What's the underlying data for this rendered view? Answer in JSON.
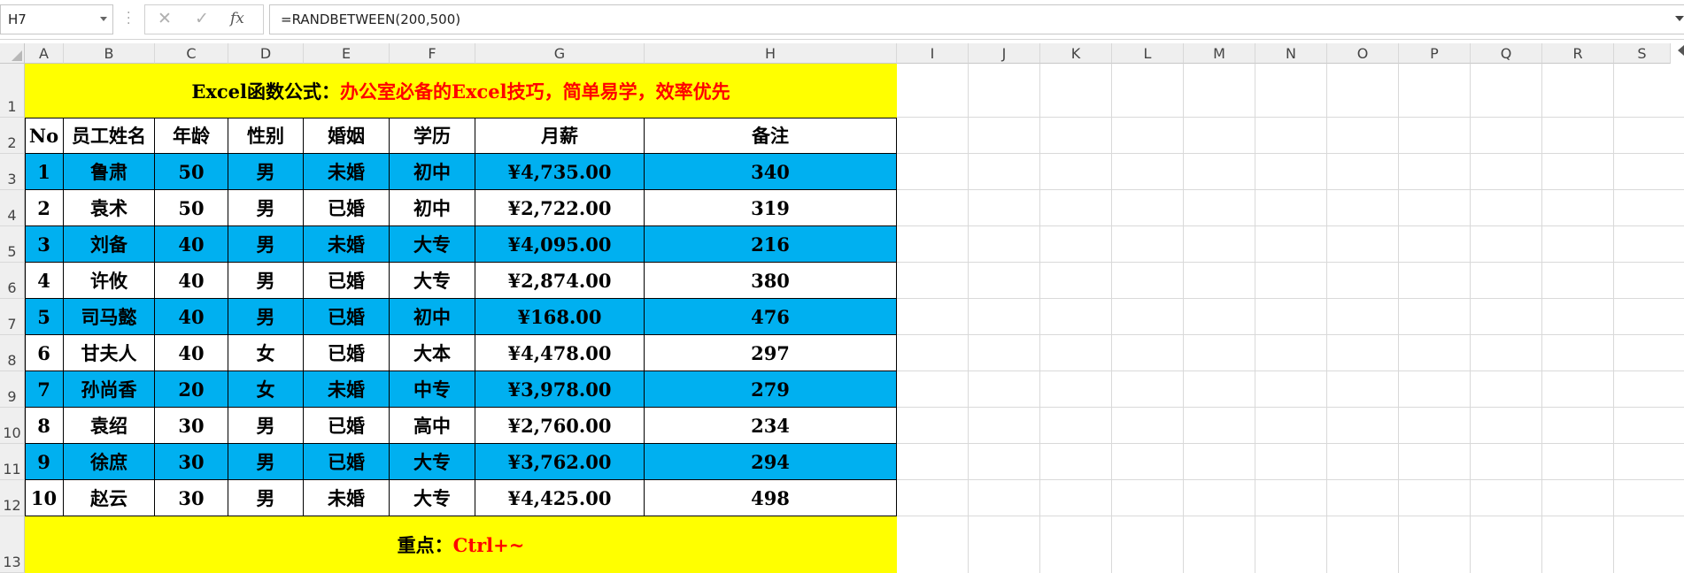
{
  "formula_bar": {
    "name_box": "H7",
    "cancel_icon": "✕",
    "enter_icon": "✓",
    "fx_label": "fx",
    "formula": "=RANDBETWEEN(200,500)"
  },
  "columns": [
    "A",
    "B",
    "C",
    "D",
    "E",
    "F",
    "G",
    "H",
    "I",
    "J",
    "K",
    "L",
    "M",
    "N",
    "O",
    "P",
    "Q",
    "R",
    "S"
  ],
  "rows": [
    "1",
    "2",
    "3",
    "4",
    "5",
    "6",
    "7",
    "8",
    "9",
    "10",
    "11",
    "12",
    "13"
  ],
  "banner_top": {
    "black": "Excel函数公式：",
    "red": "办公室必备的Excel技巧，简单易学，效率优先"
  },
  "banner_bottom": {
    "black": "重点：",
    "red": "Ctrl+~"
  },
  "table": {
    "headers": [
      "No",
      "员工姓名",
      "年龄",
      "性别",
      "婚姻",
      "学历",
      "月薪",
      "备注"
    ],
    "rows": [
      [
        "1",
        "鲁肃",
        "50",
        "男",
        "未婚",
        "初中",
        "¥4,735.00",
        "340"
      ],
      [
        "2",
        "袁术",
        "50",
        "男",
        "已婚",
        "初中",
        "¥2,722.00",
        "319"
      ],
      [
        "3",
        "刘备",
        "40",
        "男",
        "未婚",
        "大专",
        "¥4,095.00",
        "216"
      ],
      [
        "4",
        "许攸",
        "40",
        "男",
        "已婚",
        "大专",
        "¥2,874.00",
        "380"
      ],
      [
        "5",
        "司马懿",
        "40",
        "男",
        "已婚",
        "初中",
        "¥168.00",
        "476"
      ],
      [
        "6",
        "甘夫人",
        "40",
        "女",
        "已婚",
        "大本",
        "¥4,478.00",
        "297"
      ],
      [
        "7",
        "孙尚香",
        "20",
        "女",
        "未婚",
        "中专",
        "¥3,978.00",
        "279"
      ],
      [
        "8",
        "袁绍",
        "30",
        "男",
        "已婚",
        "高中",
        "¥2,760.00",
        "234"
      ],
      [
        "9",
        "徐庶",
        "30",
        "男",
        "已婚",
        "大专",
        "¥3,762.00",
        "294"
      ],
      [
        "10",
        "赵云",
        "30",
        "男",
        "未婚",
        "大专",
        "¥4,425.00",
        "498"
      ]
    ]
  },
  "colors": {
    "band_blue": "#00b0f0",
    "banner_yellow": "#ffff00",
    "accent_red": "#ff0000",
    "selection": "#217346"
  }
}
